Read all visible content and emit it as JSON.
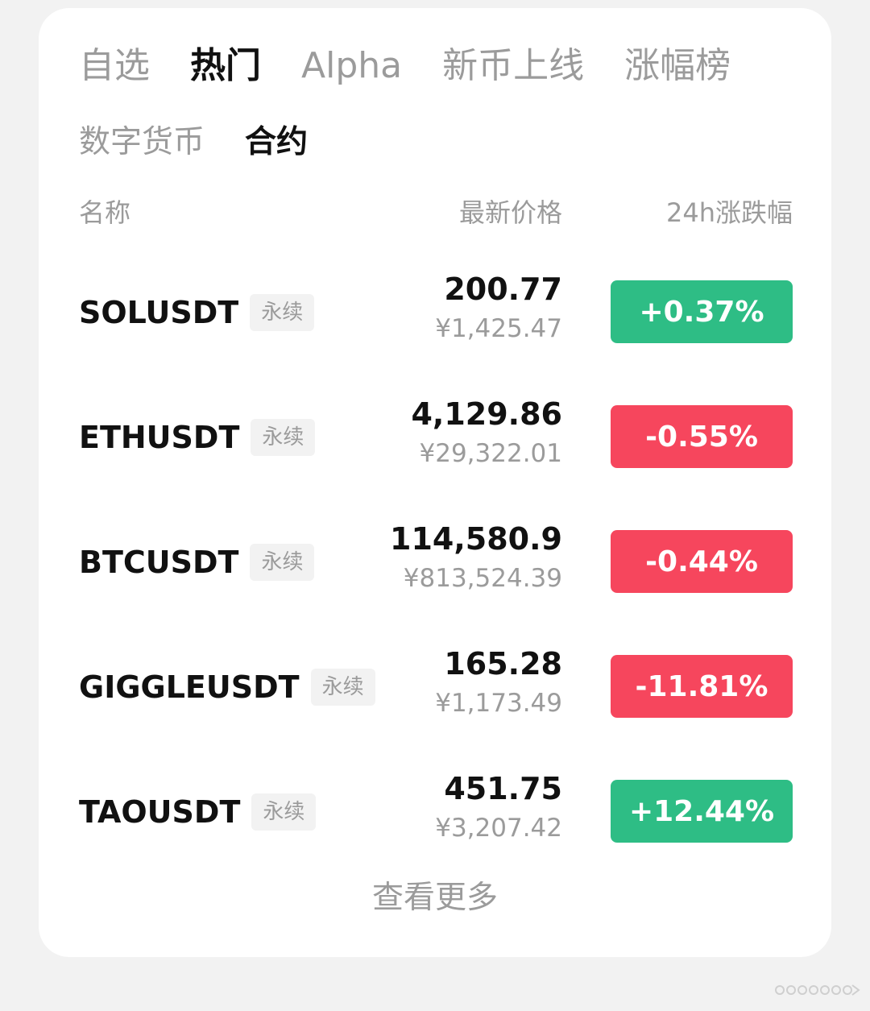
{
  "tabs": [
    {
      "label": "自选",
      "active": false
    },
    {
      "label": "热门",
      "active": true
    },
    {
      "label": "Alpha",
      "active": false
    },
    {
      "label": "新币上线",
      "active": false
    },
    {
      "label": "涨幅榜",
      "active": false
    }
  ],
  "subtabs": [
    {
      "label": "数字货币",
      "active": false
    },
    {
      "label": "合约",
      "active": true
    }
  ],
  "headers": {
    "name": "名称",
    "price": "最新价格",
    "change": "24h涨跌幅"
  },
  "rows": [
    {
      "symbol": "SOLUSDT",
      "tag": "永续",
      "price": "200.77",
      "cny": "¥1,425.47",
      "change": "+0.37%",
      "direction": "up"
    },
    {
      "symbol": "ETHUSDT",
      "tag": "永续",
      "price": "4,129.86",
      "cny": "¥29,322.01",
      "change": "-0.55%",
      "direction": "down"
    },
    {
      "symbol": "BTCUSDT",
      "tag": "永续",
      "price": "114,580.9",
      "cny": "¥813,524.39",
      "change": "-0.44%",
      "direction": "down"
    },
    {
      "symbol": "GIGGLEUSDT",
      "tag": "永续",
      "price": "165.28",
      "cny": "¥1,173.49",
      "change": "-11.81%",
      "direction": "down"
    },
    {
      "symbol": "TAOUSDT",
      "tag": "永续",
      "price": "451.75",
      "cny": "¥3,207.42",
      "change": "+12.44%",
      "direction": "up"
    }
  ],
  "more_label": "查看更多",
  "colors": {
    "up": "#2ebd85",
    "down": "#f6465d",
    "text_primary": "#111111",
    "text_secondary": "#9b9b9b"
  }
}
